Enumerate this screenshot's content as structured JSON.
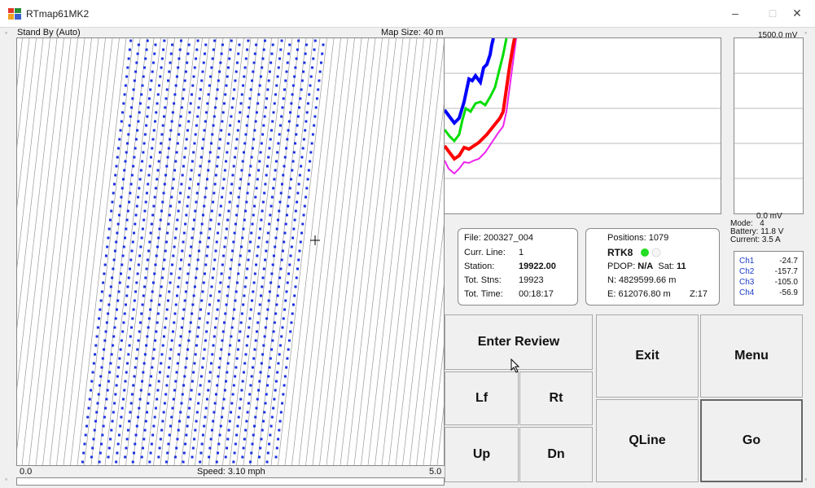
{
  "window": {
    "title": "RTmap61MK2",
    "min": "–",
    "max": "□",
    "close": "✕"
  },
  "map": {
    "status": "Stand By (Auto)",
    "map_size": "Map Size:  40 m",
    "speed": "Speed:  3.10 mph",
    "scale_min": "0.0",
    "scale_max": "5.0"
  },
  "signal": {
    "top_label": "1500.0 mV",
    "bottom_label": "0.0 mV",
    "colors": [
      "#0000ff",
      "#00dd00",
      "#ff0000",
      "#ee22ee"
    ]
  },
  "device": {
    "mode_label": "Mode:",
    "mode_value": "4",
    "battery_label": "Battery:",
    "battery_value": "11.8 V",
    "current_label": "Current:",
    "current_value": "3.5 A"
  },
  "file_panel": {
    "file": "File: 200327_004",
    "curr_line_label": "Curr. Line:",
    "curr_line": "1",
    "station_label": "Station:",
    "station": "19922.00",
    "tot_stns_label": "Tot. Stns:",
    "tot_stns": "19923",
    "tot_time_label": "Tot. Time:",
    "tot_time": "00:18:17"
  },
  "pos_panel": {
    "positions": "Positions:  1079",
    "rtk": "RTK8",
    "pdop_label": "PDOP:",
    "pdop": "N/A",
    "sat_label": "Sat:",
    "sat": "11",
    "north": "N:  4829599.66 m",
    "east": "E:  612076.80 m",
    "zone": "Z:17"
  },
  "channels": [
    {
      "name": "Ch1",
      "value": "-24.7"
    },
    {
      "name": "Ch2",
      "value": "-157.7"
    },
    {
      "name": "Ch3",
      "value": "-105.0"
    },
    {
      "name": "Ch4",
      "value": "-56.9"
    }
  ],
  "buttons": {
    "enter_review": "Enter Review",
    "exit": "Exit",
    "menu": "Menu",
    "lf": "Lf",
    "rt": "Rt",
    "qline": "QLine",
    "go": "Go",
    "up": "Up",
    "dn": "Dn"
  }
}
